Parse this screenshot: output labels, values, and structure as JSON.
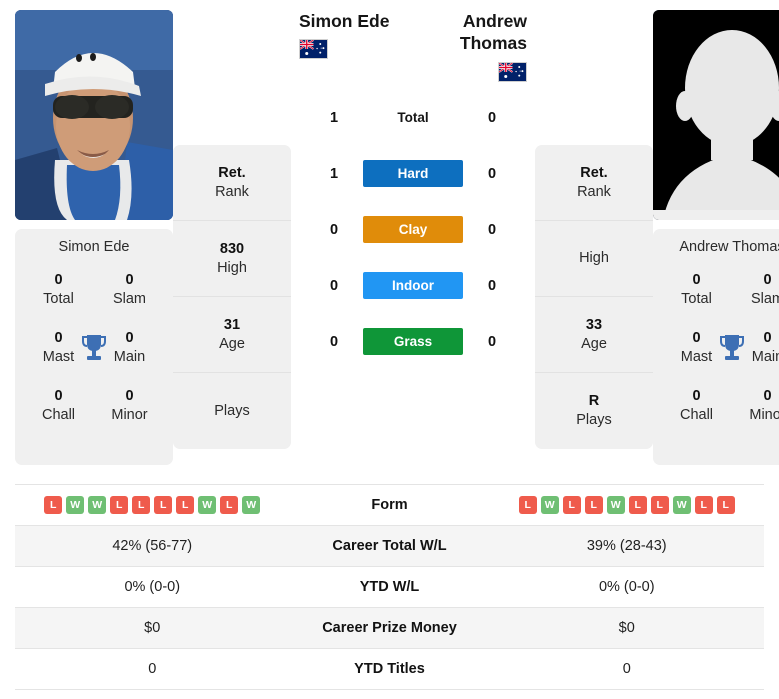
{
  "colors": {
    "win_badge": "#6fbf73",
    "loss_badge": "#ef5b4c",
    "hard": "#0d6fbf",
    "clay": "#e08c0a",
    "indoor": "#2196f3",
    "grass": "#0f9638",
    "card_bg": "#f0f0f0",
    "trophy": "#3d6fb4"
  },
  "players": {
    "left": {
      "full_name": "Simon Ede",
      "card_name": "Simon Ede",
      "flag": "australia-flag",
      "photo": "player-photo",
      "titles": [
        {
          "num": "0",
          "label": "Total"
        },
        {
          "num": "0",
          "label": "Slam"
        },
        {
          "num": "0",
          "label": "Mast"
        },
        {
          "num": "0",
          "label": "Main"
        },
        {
          "num": "0",
          "label": "Chall"
        },
        {
          "num": "0",
          "label": "Minor"
        }
      ],
      "info": [
        {
          "value": "Ret.",
          "label": "Rank"
        },
        {
          "value": "830",
          "label": "High"
        },
        {
          "value": "31",
          "label": "Age"
        },
        {
          "value": "",
          "label": "Plays"
        }
      ],
      "form": [
        "L",
        "W",
        "W",
        "L",
        "L",
        "L",
        "L",
        "W",
        "L",
        "W"
      ],
      "career_total_wl": "42% (56-77)",
      "ytd_wl": "0% (0-0)",
      "career_prize_money": "$0",
      "ytd_titles": "0"
    },
    "right": {
      "full_name": "Andrew Thomas",
      "card_name": "Andrew Thomas",
      "flag": "australia-flag",
      "photo": "player-photo-placeholder",
      "titles": [
        {
          "num": "0",
          "label": "Total"
        },
        {
          "num": "0",
          "label": "Slam"
        },
        {
          "num": "0",
          "label": "Mast"
        },
        {
          "num": "0",
          "label": "Main"
        },
        {
          "num": "0",
          "label": "Chall"
        },
        {
          "num": "0",
          "label": "Minor"
        }
      ],
      "info": [
        {
          "value": "Ret.",
          "label": "Rank"
        },
        {
          "value": "",
          "label": "High"
        },
        {
          "value": "33",
          "label": "Age"
        },
        {
          "value": "R",
          "label": "Plays"
        }
      ],
      "form": [
        "L",
        "W",
        "L",
        "L",
        "W",
        "L",
        "L",
        "W",
        "L",
        "L"
      ],
      "career_total_wl": "39% (28-43)",
      "ytd_wl": "0% (0-0)",
      "career_prize_money": "$0",
      "ytd_titles": "0"
    }
  },
  "surfaces": [
    {
      "label": "Total",
      "left": "1",
      "right": "0",
      "color": ""
    },
    {
      "label": "Hard",
      "left": "1",
      "right": "0",
      "color": "#0d6fbf"
    },
    {
      "label": "Clay",
      "left": "0",
      "right": "0",
      "color": "#e08c0a"
    },
    {
      "label": "Indoor",
      "left": "0",
      "right": "0",
      "color": "#2196f3"
    },
    {
      "label": "Grass",
      "left": "0",
      "right": "0",
      "color": "#0f9638"
    }
  ],
  "table_rows": [
    {
      "label": "Form"
    },
    {
      "label": "Career Total W/L"
    },
    {
      "label": "YTD W/L"
    },
    {
      "label": "Career Prize Money"
    },
    {
      "label": "YTD Titles"
    }
  ]
}
